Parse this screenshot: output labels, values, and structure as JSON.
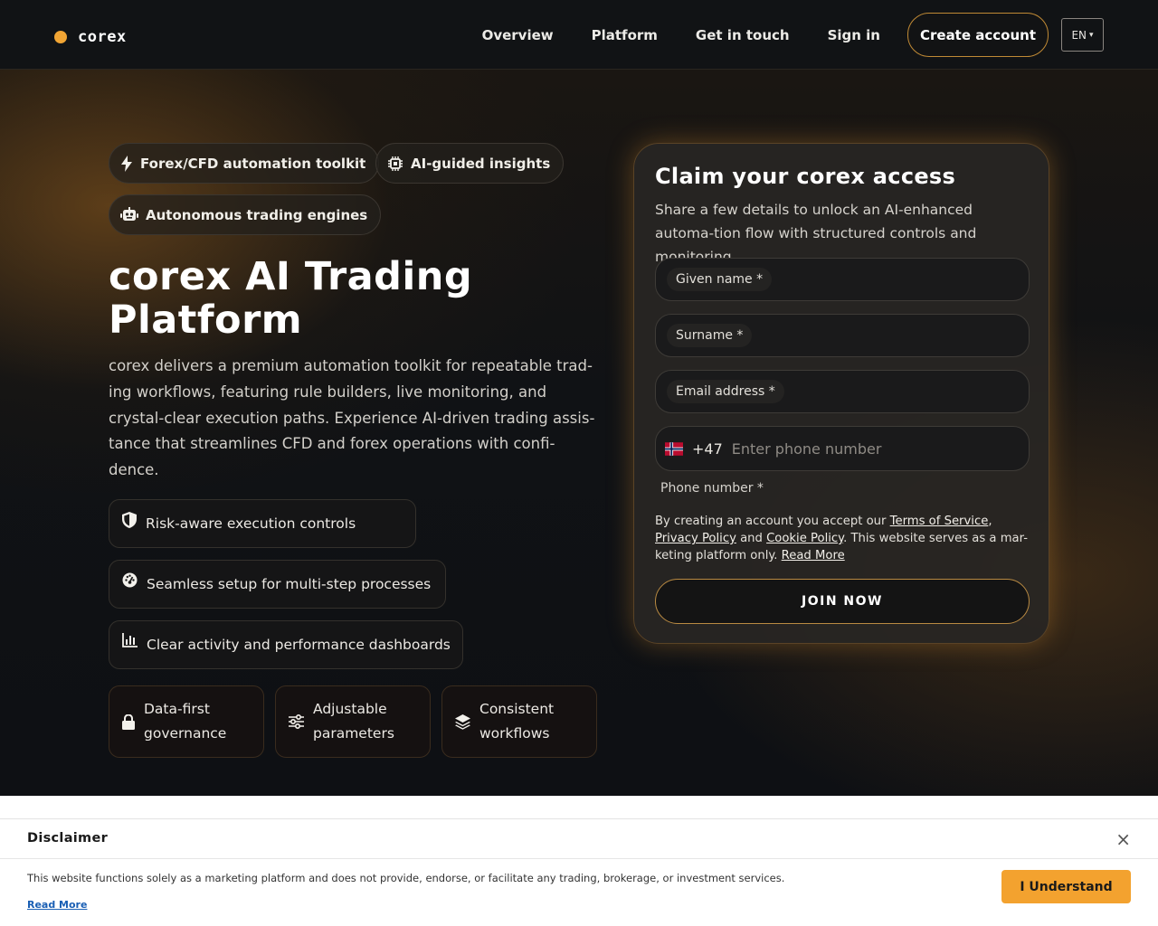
{
  "brand": {
    "name": "corex",
    "accent": "#f1a534"
  },
  "nav": {
    "items": [
      "Overview",
      "Platform",
      "Get in touch",
      "Sign in"
    ],
    "create_account": "Create account",
    "language": "EN"
  },
  "hero": {
    "pills": [
      {
        "label": "Forex/CFD automation toolkit",
        "icon": "bolt-icon"
      },
      {
        "label": "AI-guided insights",
        "icon": "chip-icon"
      },
      {
        "label": "Autonomous trading engines",
        "icon": "robot-icon"
      }
    ],
    "title_line1": "corex AI Trading",
    "title_line2": "Platform",
    "description": "corex delivers a premium automation toolkit for repeatable trad-ing workflows, featuring rule builders, live monitoring, and crystal-clear execution paths. Experience AI-driven trading assis-tance that streamlines CFD and forex operations with confi-dence.",
    "features": [
      {
        "label": "Risk-aware execution controls",
        "icon": "shield-icon"
      },
      {
        "label": "Seamless setup for multi-step processes",
        "icon": "gauge-icon"
      },
      {
        "label": "Clear activity and performance dashboards",
        "icon": "bar-chart-icon"
      }
    ],
    "mini_features": [
      {
        "line1": "Data-first",
        "line2": "governance",
        "icon": "lock-icon"
      },
      {
        "line1": "Adjustable",
        "line2": "parameters",
        "icon": "sliders-icon"
      },
      {
        "line1": "Consistent",
        "line2": "workflows",
        "icon": "layers-icon"
      }
    ]
  },
  "form": {
    "title": "Claim your corex access",
    "subtitle": "Share a few details to unlock an AI-enhanced automa-tion flow with structured controls and monitoring.",
    "given_name_label": "Given name *",
    "surname_label": "Surname *",
    "email_label": "Email address *",
    "dial_code": "+47",
    "phone_placeholder": "Enter phone number",
    "phone_label": "Phone number *",
    "terms_prefix": "By creating an account you accept our ",
    "terms_link": "Terms of Service",
    "terms_sep1": ",",
    "privacy_link": "Privacy Policy",
    "terms_and": " and ",
    "cookie_link": "Cookie Policy",
    "terms_suffix": ". This website serves as a mar-keting platform only. ",
    "read_more": "Read More",
    "join_button": "JOIN NOW"
  },
  "disclaimer": {
    "title": "Disclaimer",
    "close": "×",
    "text": "This website functions solely as a marketing platform and does not provide, endorse, or facilitate any trading, brokerage, or investment services.",
    "read_more": "Read More",
    "button": "I Understand"
  }
}
